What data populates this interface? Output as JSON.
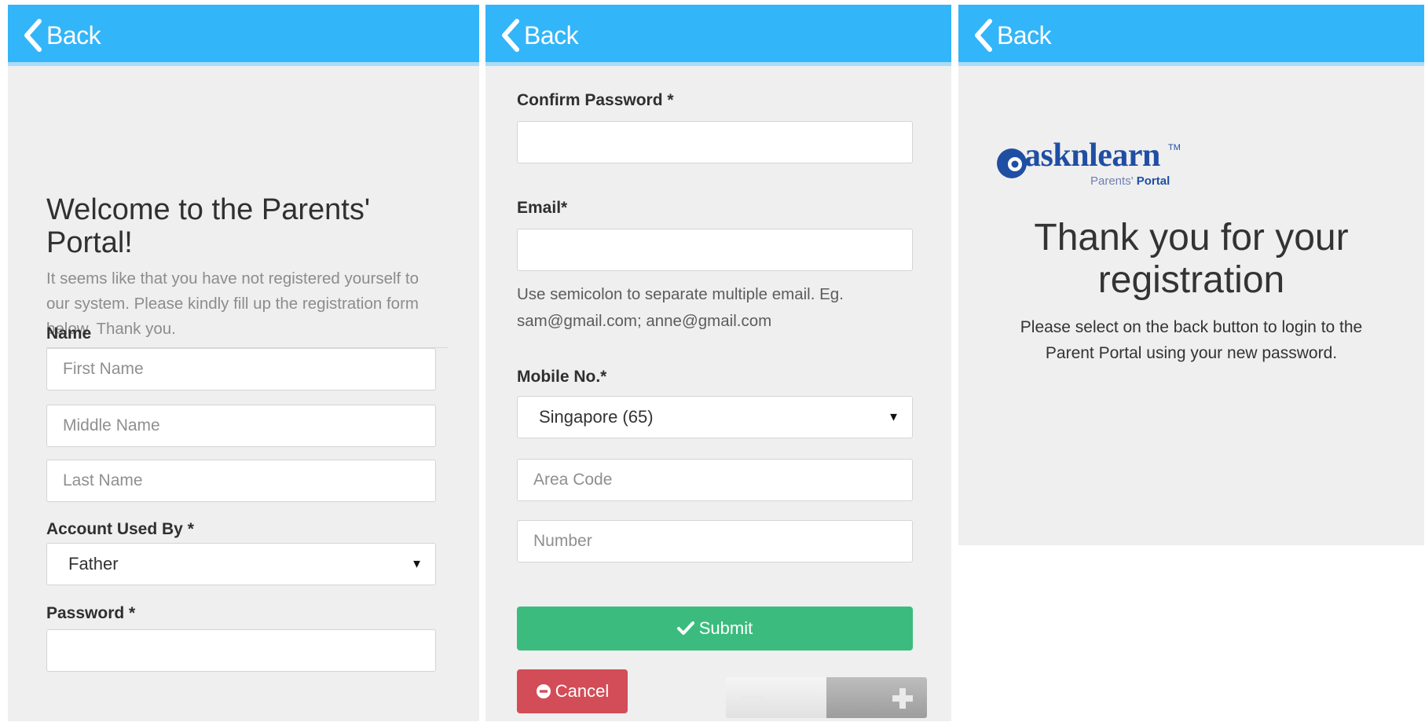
{
  "panel1": {
    "back_label": "Back",
    "welcome_title": "Welcome to the Parents' Portal!",
    "welcome_text": "It seems like that you have not registered yourself to our system. Please kindly fill up the registration form below. Thank you.",
    "name_label": "Name",
    "first_name_placeholder": "First Name",
    "middle_name_placeholder": "Middle Name",
    "last_name_placeholder": "Last Name",
    "account_used_by_label": "Account Used By *",
    "account_used_by_value": "Father",
    "password_label": "Password *"
  },
  "panel2": {
    "back_label": "Back",
    "confirm_password_label": "Confirm Password *",
    "email_label": "Email*",
    "email_hint_line1": "Use semicolon to separate multiple email. Eg.",
    "email_hint_line2": "sam@gmail.com; anne@gmail.com",
    "mobile_label": "Mobile No.*",
    "country_value": "Singapore (65)",
    "area_code_placeholder": "Area Code",
    "number_placeholder": "Number",
    "submit_label": "Submit",
    "cancel_label": "Cancel"
  },
  "panel3": {
    "back_label": "Back",
    "logo_text": "asknlearn",
    "logo_tm": "TM",
    "logo_sub_light": "Parents'",
    "logo_sub_bold": "Portal",
    "thanks_line1": "Thank you for your",
    "thanks_line2": "registration",
    "message_line1": "Please select on the back button to login to the",
    "message_line2": "Parent Portal using your new password."
  },
  "colors": {
    "topbar": "#33b5f9",
    "submit": "#3bbc7e",
    "cancel": "#d24d57",
    "logo": "#1f4ea3"
  },
  "icons": [
    "chevron-left-icon",
    "check-icon",
    "minus-circle-icon",
    "minus-icon",
    "plus-icon",
    "caret-down-icon"
  ]
}
